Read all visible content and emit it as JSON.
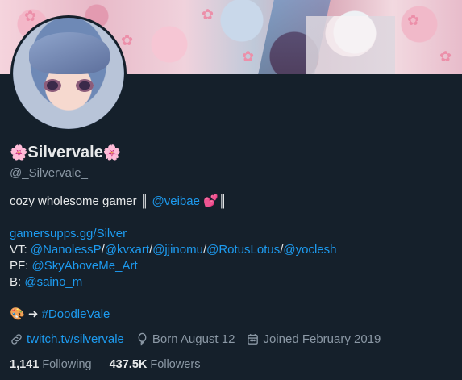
{
  "profile": {
    "display_name": "Silvervale",
    "name_emoji": "🌸",
    "handle": "@_Silvervale_"
  },
  "bio": {
    "line1_text": "cozy wholesome gamer ║ ",
    "line1_mention": "@veibae",
    "line1_heart": "💕",
    "line1_end": "║",
    "website": "gamersupps.gg/Silver",
    "vt_label": "VT: ",
    "vt_mentions": [
      "@NanolessP",
      "@kvxart",
      "@jjinomu",
      "@RotusLotus",
      "@yoclesh"
    ],
    "separator": "/",
    "pf_label": "PF: ",
    "pf_mention": "@SkyAboveMe_Art",
    "b_label": "B: ",
    "b_mention": "@saino_m",
    "art_emoji": "🎨",
    "arrow": " ➜ ",
    "hashtag": "#DoodleVale"
  },
  "meta": {
    "link": "twitch.tv/silvervale",
    "birthday": "Born August 12",
    "joined": "Joined February 2019",
    "link_icon": "link-icon",
    "birthday_icon": "balloon-icon",
    "joined_icon": "calendar-icon"
  },
  "stats": {
    "following_count": "1,141",
    "following_label": "Following",
    "followers_count": "437.5K",
    "followers_label": "Followers"
  },
  "colors": {
    "background": "#15202b",
    "link": "#1d9bf0",
    "secondary_text": "#8b98a5",
    "primary_text": "#e7e9ea"
  }
}
